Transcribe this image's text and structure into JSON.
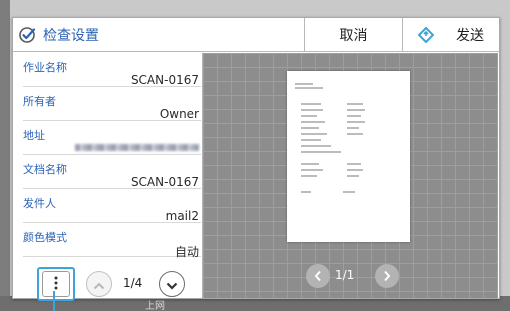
{
  "dialog": {
    "title": "检查设置",
    "cancel_label": "取消",
    "send_label": "发送"
  },
  "info_items": [
    {
      "label": "作业名称",
      "value": "SCAN-0167"
    },
    {
      "label": "所有者",
      "value": "Owner"
    },
    {
      "label": "地址",
      "value": ""
    },
    {
      "label": "文档名称",
      "value": "SCAN-0167"
    },
    {
      "label": "发件人",
      "value": "mail2"
    },
    {
      "label": "颜色模式",
      "value": "自动"
    }
  ],
  "info_pager": "1/4",
  "preview_pager": "1/1",
  "background": {
    "bottom_text": "上网"
  },
  "colors": {
    "accent": "#2a63b5",
    "callout": "#3ea3d8",
    "preview_bg": "#8d8d8d"
  },
  "icons": {
    "title": "check-circle-icon",
    "send": "send-diamond-icon",
    "menu": "vertical-dots-icon",
    "up": "chevron-up-icon",
    "down": "chevron-down-icon",
    "prev": "chevron-left-icon",
    "next": "chevron-right-icon"
  }
}
